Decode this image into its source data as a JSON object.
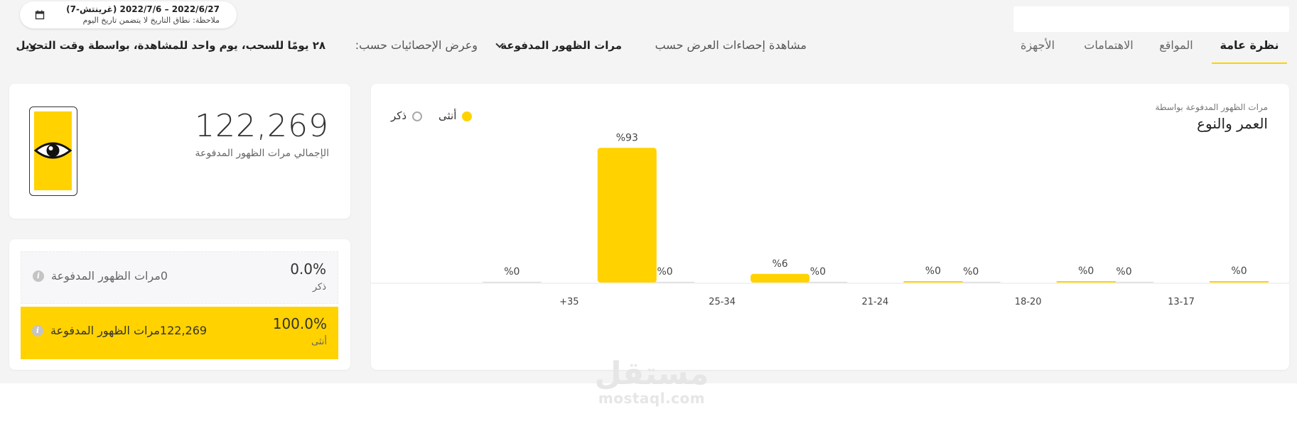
{
  "header": {
    "date_range": "2022/6/27 – 2022/7/6 (غرينتش-7)",
    "date_note": "ملاحظة: نطاق التاريخ لا يتضمن تاريخ اليوم",
    "search_placeholder": ""
  },
  "tabs": [
    {
      "label": "نظرة عامة",
      "active": true
    },
    {
      "label": "المواقع",
      "active": false
    },
    {
      "label": "الاهتمامات",
      "active": false
    },
    {
      "label": "الأجهزة",
      "active": false
    }
  ],
  "view": {
    "view_by_label": "مشاهدة إحصاءات العرض حسب",
    "view_by_value": "مرات الظهور المدفوعة",
    "stats_by_label": "وعرض الإحصائيات حسب:",
    "stats_by_value": "٢٨ يومًا للسحب، يوم واحد للمشاهدة، بواسطة وقت التحويل"
  },
  "chart_card": {
    "subtitle": "مرات الظهور المدفوعة بواسطة",
    "title": "العمر والنوع",
    "legend": [
      {
        "label": "أنثى",
        "color": "#ffd200"
      },
      {
        "label": "ذكر",
        "color": "#aaaaaa"
      }
    ]
  },
  "chart_data": {
    "type": "bar",
    "title": "العمر والنوع",
    "categories": [
      "13-17",
      "18-20",
      "21-24",
      "25-34",
      "35+"
    ],
    "series": [
      {
        "name": "أنثى",
        "values": [
          0,
          0,
          0,
          6,
          93
        ],
        "labels": [
          "0%",
          "0%",
          "0%",
          "6%",
          "93%"
        ]
      },
      {
        "name": "ذكر",
        "values": [
          0,
          0,
          0,
          0,
          0
        ],
        "labels": [
          "0%",
          "0%",
          "0%",
          "0%",
          "0%"
        ]
      }
    ],
    "category_labels": [
      "13-17",
      "18-20",
      "21-24",
      "25-34",
      "+35"
    ],
    "ylim": [
      0,
      100
    ],
    "grid": false
  },
  "total_card": {
    "value": "122,269",
    "label": "الإجمالي مرات الظهور المدفوعة"
  },
  "gender_card": {
    "male": {
      "percent": "0.0%",
      "name": "ذكر",
      "count": "0مرات الظهور المدفوعة"
    },
    "female": {
      "percent": "100.0%",
      "name": "أنثى",
      "count": "122,269مرات الظهور المدفوعة"
    }
  },
  "watermark": {
    "arabic": "مستقل",
    "latin": "mostaql.com"
  },
  "icons": [
    "calendar-icon",
    "chevron-down-icon",
    "eye-icon",
    "info-icon"
  ]
}
